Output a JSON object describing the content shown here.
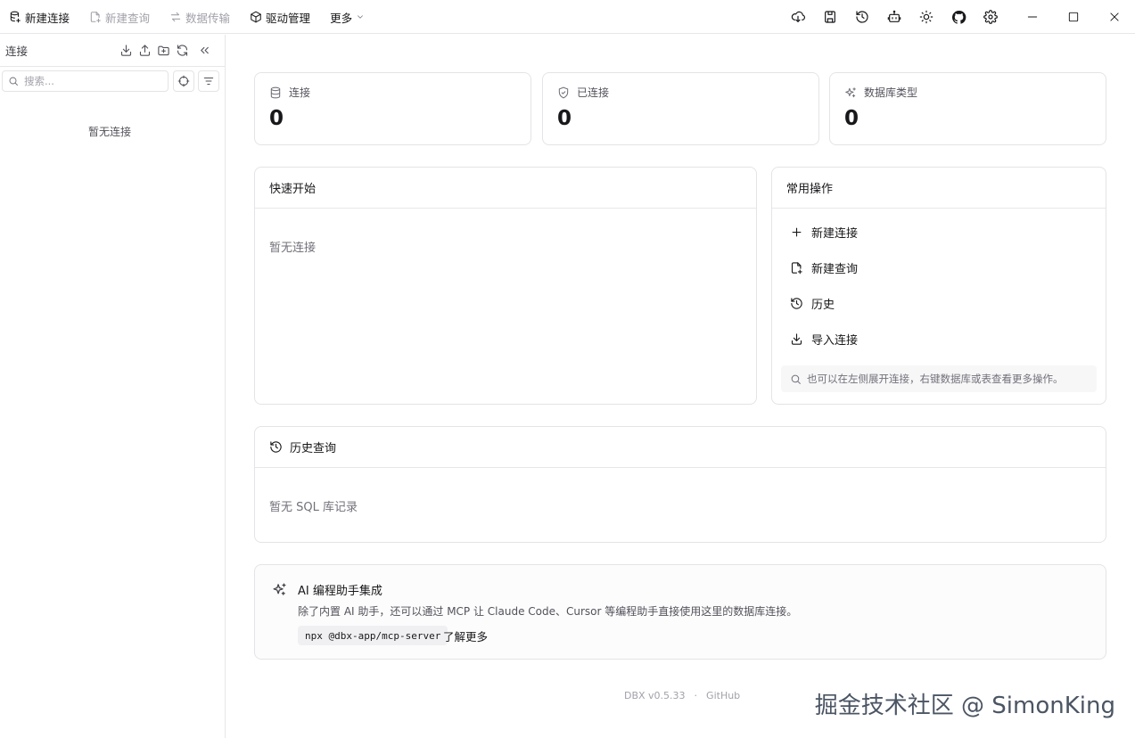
{
  "toolbar": {
    "new_connection": "新建连接",
    "new_query": "新建查询",
    "data_transfer": "数据传输",
    "driver_manage": "驱动管理",
    "more": "更多"
  },
  "sidebar": {
    "title": "连接",
    "search_placeholder": "搜索...",
    "empty_text": "暂无连接"
  },
  "stats": [
    {
      "label": "连接",
      "value": "0",
      "icon": "database-icon"
    },
    {
      "label": "已连接",
      "value": "0",
      "icon": "shield-check-icon"
    },
    {
      "label": "数据库类型",
      "value": "0",
      "icon": "sparkles-icon"
    }
  ],
  "quick_start": {
    "title": "快速开始",
    "empty_text": "暂无连接"
  },
  "common_actions": {
    "title": "常用操作",
    "items": [
      {
        "label": "新建连接",
        "icon": "plus-icon"
      },
      {
        "label": "新建查询",
        "icon": "file-plus-icon"
      },
      {
        "label": "历史",
        "icon": "history-icon"
      },
      {
        "label": "导入连接",
        "icon": "download-icon"
      }
    ],
    "hint": "也可以在左侧展开连接，右键数据库或表查看更多操作。"
  },
  "history": {
    "title": "历史查询",
    "empty_text": "暂无 SQL 库记录"
  },
  "ai": {
    "title": "AI 编程助手集成",
    "description": "除了内置 AI 助手，还可以通过 MCP 让 Claude Code、Cursor 等编程助手直接使用这里的数据库连接。",
    "command": "npx @dbx-app/mcp-server",
    "link": "了解更多"
  },
  "footer": {
    "version": "DBX v0.5.33",
    "separator": "·",
    "github": "GitHub"
  },
  "watermark": "掘金技术社区 @ SimonKing"
}
